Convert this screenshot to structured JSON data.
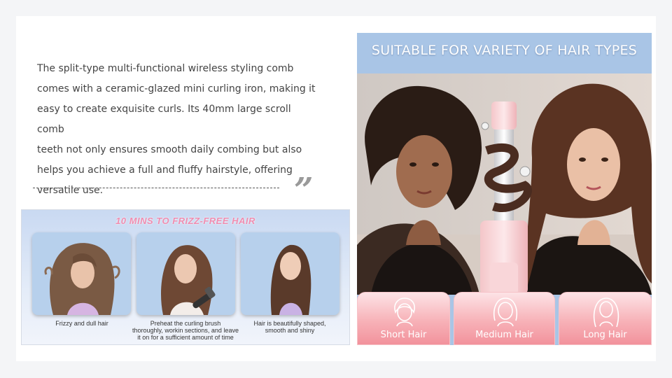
{
  "description": {
    "lines": [
      "The split-type multi-functional wireless styling comb",
      "comes with a ceramic-glazed mini curling iron, making it",
      "easy to create exquisite curls. Its 40mm large scroll comb",
      "teeth not only ensures smooth daily combing but also",
      "helps you achieve a full and fluffy hairstyle, offering",
      "versatile use."
    ],
    "quote_mark": "”"
  },
  "frizz_panel": {
    "title": "10 MINS TO FRIZZ-FREE HAIR",
    "steps": [
      {
        "caption_lines": [
          "Frizzy and dull hair"
        ]
      },
      {
        "caption_lines": [
          "Preheat the curling brush",
          "thoroughly, workin sections, and leave",
          "it on for a sufficient amount of time"
        ]
      },
      {
        "caption_lines": [
          "Hair is beautifully shaped,",
          "smooth and shiny"
        ]
      }
    ]
  },
  "hair_types": {
    "title": "SUITABLE FOR VARIETY OF HAIR TYPES",
    "tiles": [
      {
        "label": "Short Hair",
        "icon": "short-hair-icon"
      },
      {
        "label": "Medium Hair",
        "icon": "medium-hair-icon"
      },
      {
        "label": "Long Hair",
        "icon": "long-hair-icon"
      }
    ]
  },
  "colors": {
    "accent_pink": "#f2929c",
    "panel_blue": "#a9c5e6",
    "frizz_title": "#f08db0"
  }
}
